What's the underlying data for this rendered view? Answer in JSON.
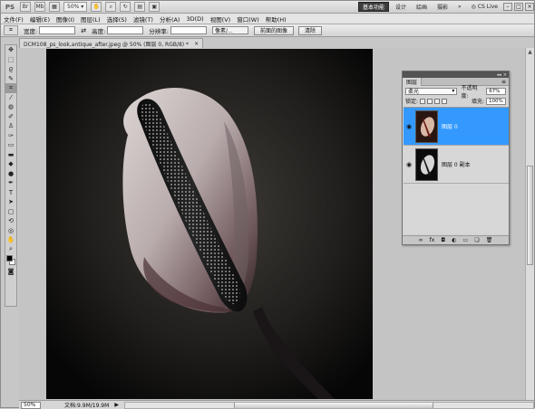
{
  "appbar": {
    "logo": "PS",
    "zoom": "50%",
    "workspaces": [
      "基本功能",
      "设计",
      "绘画",
      "摄影"
    ],
    "more": "»",
    "cslive": "CS Live"
  },
  "menu": [
    "文件(F)",
    "编辑(E)",
    "图像(I)",
    "图层(L)",
    "选择(S)",
    "滤镜(T)",
    "分析(A)",
    "3D(D)",
    "视图(V)",
    "窗口(W)",
    "帮助(H)"
  ],
  "options": {
    "width_label": "宽度:",
    "height_label": "高度:",
    "resolution_label": "分辨率:",
    "unit": "像素/...",
    "front_image": "前面的图像",
    "clear": "清除"
  },
  "document": {
    "tab_title": "DCM108_ps_look,antique_after.jpeg @ 50% (图层 0, RGB/8) *",
    "close": "×"
  },
  "status": {
    "zoom": "50%",
    "doc_info": "文档:9.9M/19.9M",
    "arrow": "▶"
  },
  "layers_panel": {
    "tab": "图层",
    "blend_mode": "柔光",
    "opacity_label": "不透明度:",
    "opacity": "67%",
    "lock_label": "锁定:",
    "fill_label": "填充:",
    "fill": "100%",
    "layers": [
      {
        "name": "图层 0",
        "visible": true,
        "selected": true
      },
      {
        "name": "图层 0 副本",
        "visible": true,
        "selected": false
      }
    ],
    "footer_icons": [
      "link-icon",
      "fx-icon",
      "mask-icon",
      "adjustment-icon",
      "group-icon",
      "new-layer-icon",
      "trash-icon"
    ]
  },
  "colors": {
    "selection": "#3399ff",
    "canvas_bg": "#000000",
    "workspace_active": "#3d3d3d"
  }
}
